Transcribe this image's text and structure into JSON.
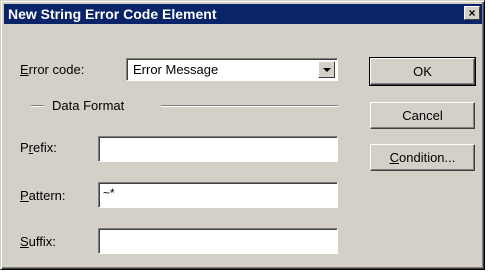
{
  "window": {
    "title": "New String Error Code Element",
    "close_glyph": "×"
  },
  "form": {
    "error_code": {
      "label_accel": "E",
      "label_rest": "rror code:",
      "value": "Error Message"
    },
    "group_label": "Data Format",
    "prefix": {
      "label_pre": "P",
      "label_accel": "r",
      "label_rest": "efix:",
      "value": ""
    },
    "pattern": {
      "label_accel": "P",
      "label_rest": "attern:",
      "value": "~*"
    },
    "suffix": {
      "label_accel": "S",
      "label_rest": "uffix:",
      "value": ""
    }
  },
  "buttons": {
    "ok": "OK",
    "cancel": "Cancel",
    "condition_accel": "C",
    "condition_rest": "ondition..."
  }
}
